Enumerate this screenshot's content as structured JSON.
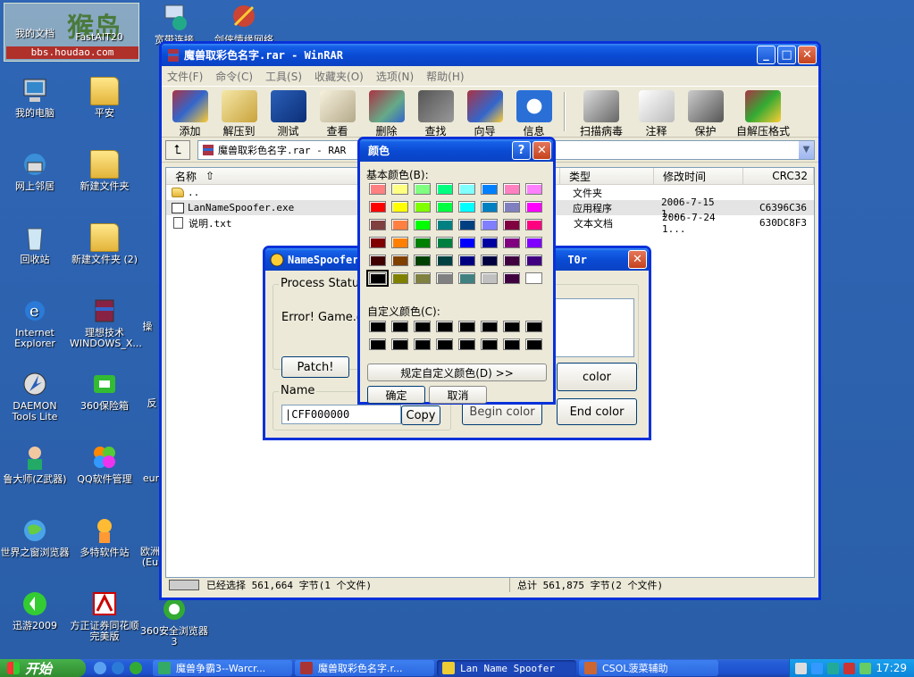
{
  "desktop": {
    "watermark": {
      "title": "猴岛",
      "url": "bbs.houdao.com"
    },
    "icons": [
      {
        "label": "我的文档"
      },
      {
        "label": "FastAIT20"
      },
      {
        "label": "宽带连接"
      },
      {
        "label": "剑侠情缘网络"
      },
      {
        "label": "我的电脑"
      },
      {
        "label": "平安"
      },
      {
        "label": "网上邻居"
      },
      {
        "label": "新建文件夹"
      },
      {
        "label": "回收站"
      },
      {
        "label": "新建文件夹 (2)"
      },
      {
        "label": "Internet Explorer"
      },
      {
        "label": "理想技术 WINDOWS_X..."
      },
      {
        "label": "操"
      },
      {
        "label": "DAEMON Tools Lite"
      },
      {
        "label": "360保险箱"
      },
      {
        "label": "反"
      },
      {
        "label": "鲁大师(Z武器)"
      },
      {
        "label": "QQ软件管理"
      },
      {
        "label": "eur"
      },
      {
        "label": "世界之窗浏览器"
      },
      {
        "label": "多特软件站"
      },
      {
        "label": "欧洲(Eu"
      },
      {
        "label": "迅游2009"
      },
      {
        "label": "方正证券同花顺完美版"
      },
      {
        "label": "360安全浏览器 3"
      }
    ]
  },
  "winrar": {
    "title": "魔兽取彩色名字.rar - WinRAR",
    "menu": [
      "文件(F)",
      "命令(C)",
      "工具(S)",
      "收藏夹(O)",
      "选项(N)",
      "帮助(H)"
    ],
    "toolbar": [
      {
        "label": "添加",
        "icon": "add-icon"
      },
      {
        "label": "解压到",
        "icon": "extract-icon"
      },
      {
        "label": "测试",
        "icon": "test-icon"
      },
      {
        "label": "查看",
        "icon": "view-icon"
      },
      {
        "label": "删除",
        "icon": "delete-icon"
      },
      {
        "label": "查找",
        "icon": "find-icon"
      },
      {
        "label": "向导",
        "icon": "wizard-icon"
      },
      {
        "label": "信息",
        "icon": "info-icon"
      },
      {
        "label": "扫描病毒",
        "icon": "virus-scan-icon"
      },
      {
        "label": "注释",
        "icon": "comment-icon"
      },
      {
        "label": "保护",
        "icon": "protect-icon"
      },
      {
        "label": "自解压格式",
        "icon": "sfx-icon"
      }
    ],
    "address": "魔兽取彩色名字.rar - RAR",
    "columns": {
      "name": "名称",
      "type": "类型",
      "modified": "修改时间",
      "crc": "CRC32"
    },
    "files": [
      {
        "name": "..",
        "type": "文件夹",
        "modified": "",
        "crc": ""
      },
      {
        "name": "LanNameSpoofer.exe",
        "type": "应用程序",
        "modified": "2006-7-15 1...",
        "crc": "C6396C36"
      },
      {
        "name": "说明.txt",
        "type": "文本文档",
        "modified": "2006-7-24 1...",
        "crc": "630DC8F3"
      }
    ],
    "status_left": "已经选择 561,664 字节(1 个文件)",
    "status_right": "总计 561,875 字节(2 个文件)"
  },
  "spoofer": {
    "title": "NameSpoofer",
    "title_tail": "T0r",
    "process_status_label": "Process Status",
    "error_text": "Error! Game.dll",
    "patch_button": "Patch!",
    "name_label": "Name",
    "name_value": "|CFF000000",
    "copy_button": "Copy",
    "begin_color_button": "Begin color",
    "end_color_button": "End color",
    "color_button": "color"
  },
  "color_dialog": {
    "title": "颜色",
    "basic_colors_label": "基本颜色(B):",
    "custom_colors_label": "自定义颜色(C):",
    "define_custom_button": "规定自定义颜色(D) >>",
    "ok_button": "确定",
    "cancel_button": "取消",
    "basic_colors": [
      "#ff8080",
      "#ffff80",
      "#80ff80",
      "#00ff80",
      "#80ffff",
      "#0080ff",
      "#ff80c0",
      "#ff80ff",
      "#ff0000",
      "#ffff00",
      "#80ff00",
      "#00ff40",
      "#00ffff",
      "#0080c0",
      "#8080c0",
      "#ff00ff",
      "#804040",
      "#ff8040",
      "#00ff00",
      "#008080",
      "#004080",
      "#8080ff",
      "#800040",
      "#ff0080",
      "#800000",
      "#ff8000",
      "#008000",
      "#008040",
      "#0000ff",
      "#0000a0",
      "#800080",
      "#8000ff",
      "#400000",
      "#804000",
      "#004000",
      "#004040",
      "#000080",
      "#000040",
      "#400040",
      "#400080",
      "#000000",
      "#808000",
      "#808040",
      "#808080",
      "#408080",
      "#c0c0c0",
      "#400040",
      "#ffffff"
    ],
    "selected_index": 40
  },
  "taskbar": {
    "start": "开始",
    "tasks": [
      {
        "label": "魔兽争霸3--Warcr...",
        "color": "#3a6"
      },
      {
        "label": "魔兽取彩色名字.r...",
        "color": "#a33"
      },
      {
        "label": "Lan Name Spoofer",
        "color": "#ec3"
      },
      {
        "label": "CSOL菠菜辅助",
        "color": "#c63"
      }
    ],
    "time": "17:29"
  }
}
